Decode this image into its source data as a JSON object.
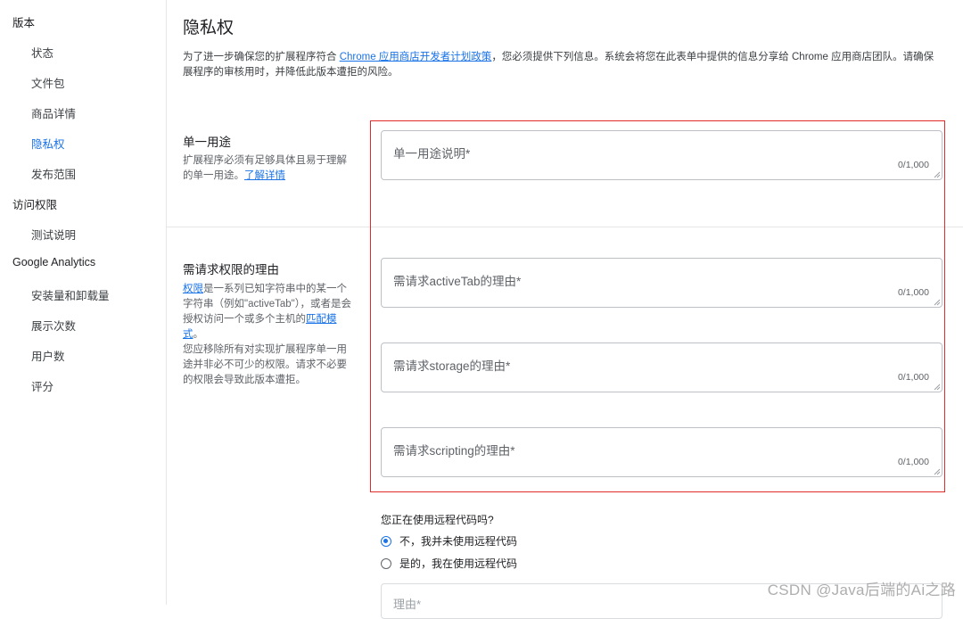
{
  "sidebar": {
    "items": [
      {
        "label": "版本"
      },
      {
        "label": "状态"
      },
      {
        "label": "文件包"
      },
      {
        "label": "商品详情"
      },
      {
        "label": "隐私权"
      },
      {
        "label": "发布范围"
      },
      {
        "label": "访问权限"
      },
      {
        "label": "测试说明"
      },
      {
        "label": "Google Analytics"
      },
      {
        "label": "安装量和卸载量"
      },
      {
        "label": "展示次数"
      },
      {
        "label": "用户数"
      },
      {
        "label": "评分"
      }
    ],
    "active_item": "隐私权"
  },
  "page": {
    "title": "隐私权",
    "intro_prefix": "为了进一步确保您的扩展程序符合 ",
    "intro_link": "Chrome 应用商店开发者计划政策",
    "intro_suffix_line1": "，您必须提供下列信息。系统会将您在此表单中提供的信息分享给 Chrome 应用商店团队。请确保",
    "intro_line2": "展程序的审核用时，并降低此版本遭拒的风险。"
  },
  "single_purpose": {
    "title": "单一用途",
    "desc": "扩展程序必须有足够具体且易于理解的单一用途。",
    "learn_more": "了解详情",
    "field_label": "单一用途说明*",
    "counter": "0/1,000"
  },
  "permissions": {
    "title": "需请求权限的理由",
    "desc_link1": "权限",
    "desc_part1": "是一系列已知字符串中的某一个字符串（例如\"activeTab\"），或者是会授权访问一个或多个主机的",
    "desc_link2": "匹配模式",
    "desc_part2": "。",
    "desc_part3": "您应移除所有对实现扩展程序单一用途并非必不可少的权限。请求不必要的权限会导致此版本遭拒。",
    "fields": [
      {
        "label": "需请求activeTab的理由*",
        "counter": "0/1,000"
      },
      {
        "label": "需请求storage的理由*",
        "counter": "0/1,000"
      },
      {
        "label": "需请求scripting的理由*",
        "counter": "0/1,000"
      }
    ]
  },
  "remote_code": {
    "question": "您正在使用远程代码吗?",
    "options": [
      {
        "label": "不，我并未使用远程代码",
        "checked": true
      },
      {
        "label": "是的，我在使用远程代码",
        "checked": false
      }
    ],
    "reason_label": "理由*"
  },
  "watermark": "CSDN @Java后端的Ai之路",
  "colors": {
    "accent": "#1a73e8",
    "highlight": "#e02b2b"
  }
}
